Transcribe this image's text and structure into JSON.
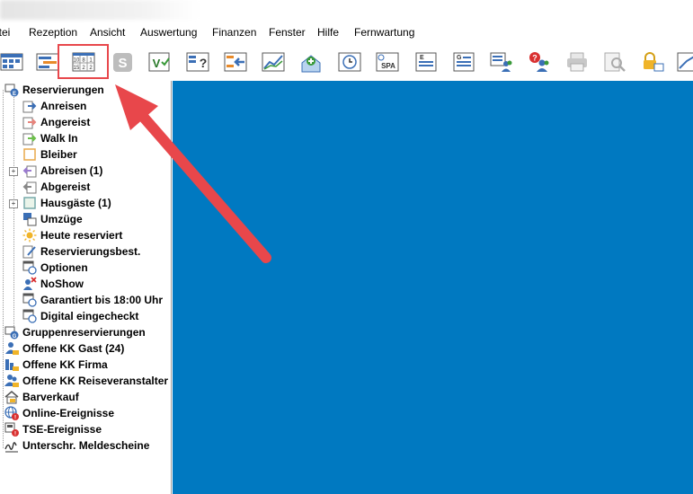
{
  "menu": [
    "atei",
    "Rezeption",
    "Ansicht",
    "Auswertung",
    "Finanzen",
    "Fenster",
    "Hilfe",
    "Fernwartung"
  ],
  "toolbar": {
    "icons": [
      "room-plan-icon",
      "reservation-list-icon",
      "calendar-grid-icon",
      "s-badge-icon",
      "v-check-icon",
      "question-grid-icon",
      "arrow-in-icon",
      "chart-icon",
      "add-house-icon",
      "clock-icon",
      "spa-icon",
      "e-document-icon",
      "g-document-icon",
      "guests-icon",
      "guests-alert-icon",
      "printer-icon",
      "print-preview-icon",
      "lock-screen-icon",
      "chart-export-icon"
    ]
  },
  "tree": {
    "root": "Reservierungen",
    "children": [
      "Anreisen",
      "Angereist",
      "Walk In",
      "Bleiber",
      "Abreisen (1)",
      "Abgereist",
      "Hausgäste (1)",
      "Umzüge",
      "Heute reserviert",
      "Reservierungsbest.",
      "Optionen",
      "NoShow",
      "Garantiert bis 18:00 Uhr",
      "Digital eingecheckt"
    ],
    "top_level": [
      "Gruppenreservierungen",
      "Offene KK Gast (24)",
      "Offene KK Firma",
      "Offene KK Reiseveranstalter",
      "Barverkauf",
      "Online-Ereignisse",
      "TSE-Ereignisse",
      "Unterschr. Meldescheine"
    ]
  },
  "colors": {
    "main_background": "#0079c1",
    "highlight": "#e8474b",
    "arrow": "#e8474b"
  },
  "calendar_icon_digits": [
    "10",
    "8",
    "1",
    "15",
    "2",
    "2"
  ]
}
